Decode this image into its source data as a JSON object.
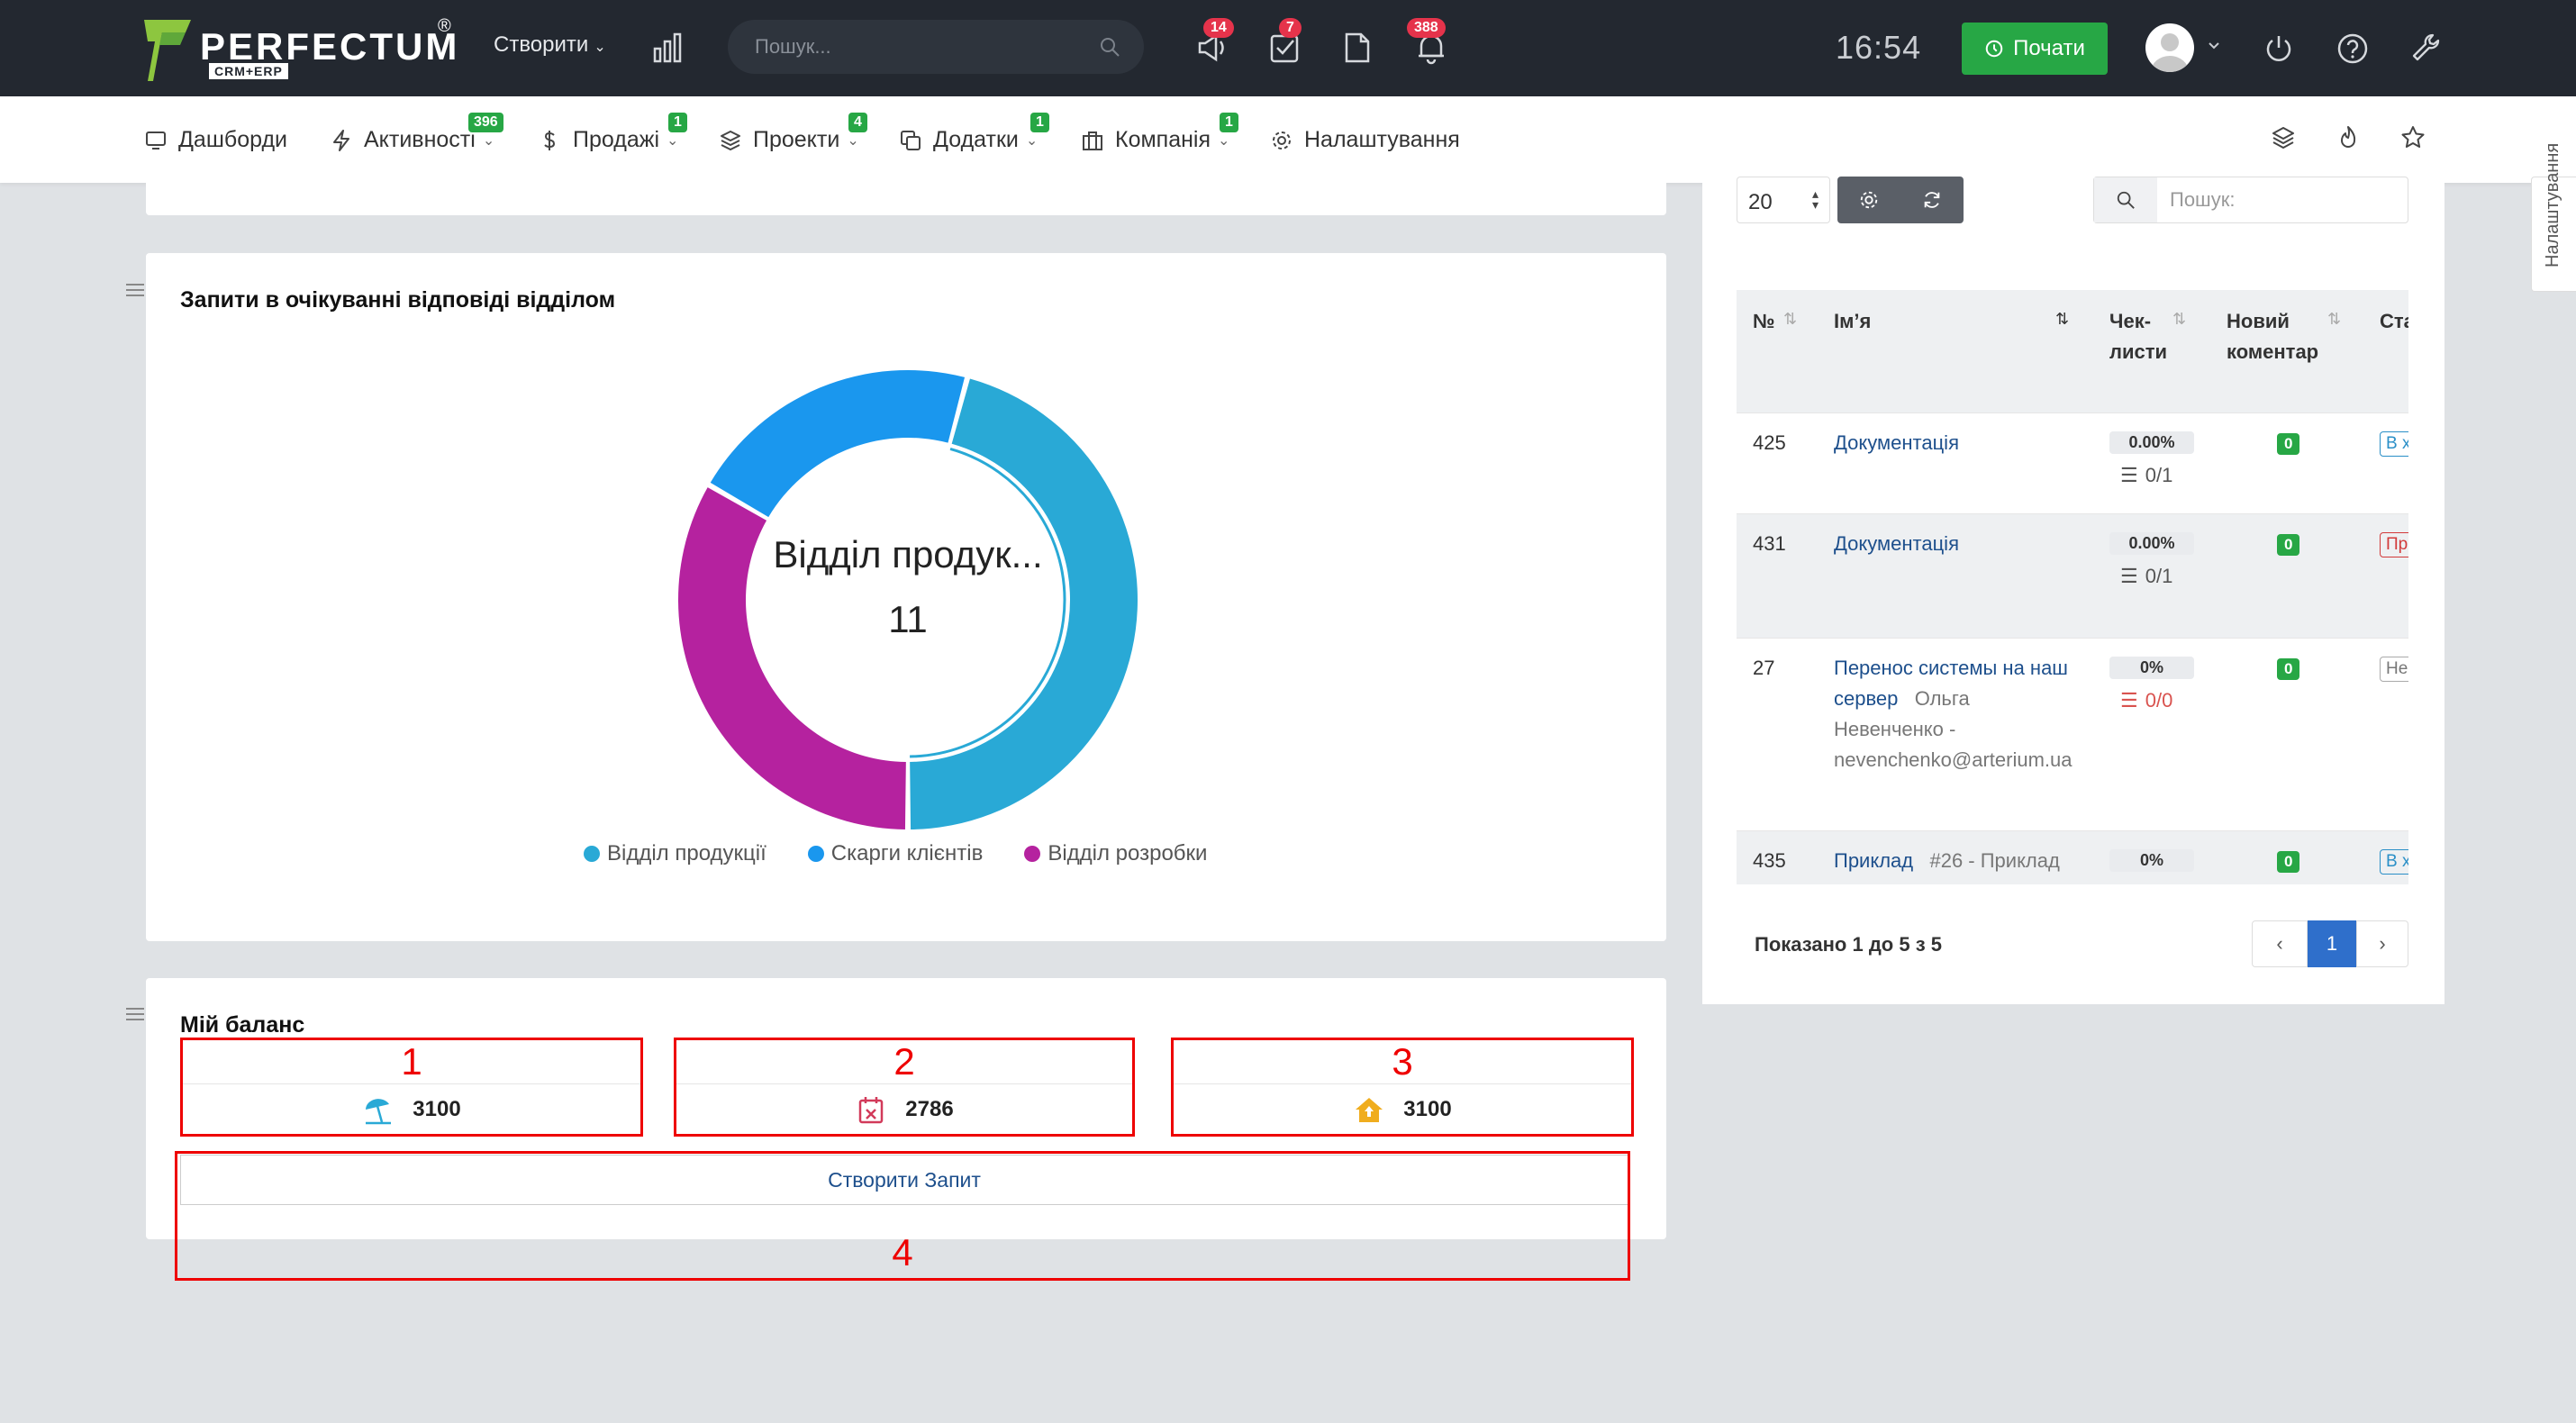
{
  "topbar": {
    "logo_text": "PERFECTUM",
    "logo_reg": "®",
    "logo_sub": "CRM+ERP",
    "create_label": "Створити",
    "search_placeholder": "Пошук...",
    "badges": {
      "announcements": "14",
      "tasks": "7",
      "notifications": "388"
    },
    "clock": "16:54",
    "start_label": "Почати"
  },
  "nav": {
    "items": [
      {
        "label": "Дашборди",
        "badge": ""
      },
      {
        "label": "Активності",
        "badge": "396"
      },
      {
        "label": "Продажі",
        "badge": "1"
      },
      {
        "label": "Проекти",
        "badge": "4"
      },
      {
        "label": "Додатки",
        "badge": "1"
      },
      {
        "label": "Компанія",
        "badge": "1"
      },
      {
        "label": "Налаштування",
        "badge": ""
      }
    ]
  },
  "pending_card": {
    "title": "Запити в очікуванні відповіді відділом",
    "center_label": "Відділ продук...",
    "center_value": "11",
    "chart_data": {
      "type": "pie",
      "categories": [
        "Відділ продукції",
        "Скарги клієнтів",
        "Відділ розробки"
      ],
      "values": [
        11,
        5,
        8
      ],
      "colors": [
        "#29a9d6",
        "#1a97ee",
        "#b5229f"
      ]
    }
  },
  "balance_card": {
    "title": "Мій баланс",
    "items": [
      {
        "marker": "1",
        "value": "3100",
        "icon": "beach-umbrella-icon"
      },
      {
        "marker": "2",
        "value": "2786",
        "icon": "calendar-x-icon"
      },
      {
        "marker": "3",
        "value": "3100",
        "icon": "house-up-icon"
      }
    ],
    "create_request_label": "Створити Запит",
    "create_marker": "4"
  },
  "table": {
    "page_length": "20",
    "search_placeholder": "Пошук:",
    "headers": {
      "num": "№",
      "name": "Ім’я",
      "checklists_1": "Чек-",
      "checklists_2": "листи",
      "comment_1": "Новий",
      "comment_2": "коментар",
      "status": "Ста"
    },
    "rows": [
      {
        "num": "425",
        "name": "Документація",
        "extra": "",
        "pct": "0.00%",
        "check": "0/1",
        "comments": "0",
        "status": "В х"
      },
      {
        "num": "431",
        "name": "Документація",
        "extra": "",
        "pct": "0.00%",
        "check": "0/1",
        "comments": "0",
        "status": "Пр"
      },
      {
        "num": "27",
        "name_1": "Перенос системы на наш",
        "name_2": "сервер",
        "extra_1": "Ольга",
        "extra_2": "Невенченко -",
        "extra_3": "nevenchenko@arterium.ua",
        "pct": "0%",
        "check": "0/0",
        "comments": "0",
        "status": "Не"
      },
      {
        "num": "435",
        "name": "Приклад",
        "extra": "#26 - Приклад",
        "pct": "0%",
        "check": "",
        "comments": "0",
        "status": "В х"
      }
    ],
    "showing": "Показано 1 до 5 з 5",
    "page": "1"
  },
  "settings_tab": "Налаштування"
}
